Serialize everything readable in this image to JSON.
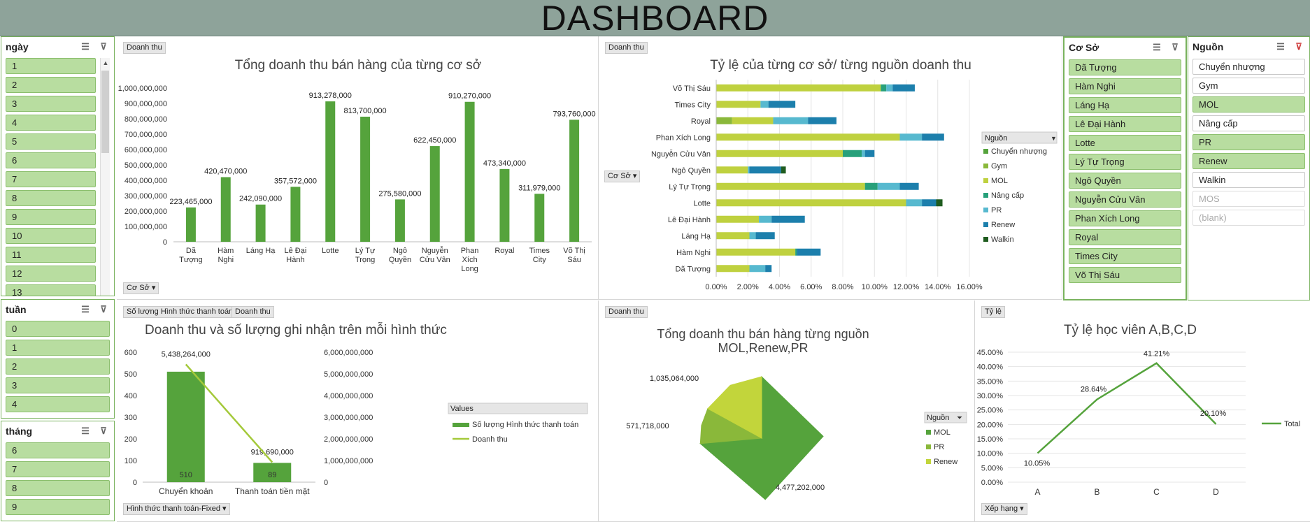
{
  "title": "DASHBOARD",
  "slicers": {
    "ngay": {
      "label": "ngày",
      "items": [
        "1",
        "2",
        "3",
        "4",
        "5",
        "6",
        "7",
        "8",
        "9",
        "10",
        "11",
        "12",
        "13"
      ]
    },
    "tuan": {
      "label": "tuần",
      "items": [
        "0",
        "1",
        "2",
        "3",
        "4"
      ]
    },
    "thang": {
      "label": "tháng",
      "items": [
        "6",
        "7",
        "8",
        "9"
      ]
    },
    "coso": {
      "label": "Cơ Sở",
      "items": [
        "Dã Tượng",
        "Hàm Nghi",
        "Láng Hạ",
        "Lê Đại Hành",
        "Lotte",
        "Lý Tự Trọng",
        "Ngô Quyền",
        "Nguyễn Cửu Vân",
        "Phan Xích Long",
        "Royal",
        "Times City",
        "Võ Thị Sáu"
      ]
    },
    "nguon": {
      "label": "Nguồn",
      "items": [
        {
          "label": "Chuyển nhượng",
          "state": "off"
        },
        {
          "label": "Gym",
          "state": "off"
        },
        {
          "label": "MOL",
          "state": "on"
        },
        {
          "label": "Nâng cấp",
          "state": "off"
        },
        {
          "label": "PR",
          "state": "on"
        },
        {
          "label": "Renew",
          "state": "on"
        },
        {
          "label": "Walkin",
          "state": "off"
        },
        {
          "label": "MOS",
          "state": "dim"
        },
        {
          "label": "(blank)",
          "state": "dim"
        }
      ]
    }
  },
  "panels": {
    "p1": {
      "field_button": "Doanh thu",
      "axis_button": "Cơ Sở"
    },
    "p2": {
      "field_button": "Doanh thu",
      "axis_button": "Cơ Sở"
    },
    "p3": {
      "field_button_1": "Số lượng Hình thức thanh toán",
      "field_button_2": "Doanh thu",
      "axis_button": "Hình thức thanh toán-Fixed"
    },
    "p4": {
      "field_button": "Doanh thu"
    },
    "p5": {
      "field_button": "Tỷ lệ",
      "axis_button": "Xếp hạng"
    }
  },
  "chart_data": [
    {
      "type": "bar",
      "title": "Tổng doanh thu bán hàng của từng cơ sở",
      "categories": [
        "Dã Tượng",
        "Hàm Nghi",
        "Láng Hạ",
        "Lê Đại Hành",
        "Lotte",
        "Lý Tự Trọng",
        "Ngô Quyền",
        "Nguyễn Cửu Vân",
        "Phan Xích Long",
        "Royal",
        "Times City",
        "Võ Thị Sáu"
      ],
      "category_lines": [
        [
          "Dã",
          "Tượng"
        ],
        [
          "Hàm",
          "Nghi"
        ],
        [
          "Láng Hạ"
        ],
        [
          "Lê Đại",
          "Hành"
        ],
        [
          "Lotte"
        ],
        [
          "Lý Tự",
          "Trọng"
        ],
        [
          "Ngô",
          "Quyền"
        ],
        [
          "Nguyễn",
          "Cửu Vân"
        ],
        [
          "Phan",
          "Xích",
          "Long"
        ],
        [
          "Royal"
        ],
        [
          "Times",
          "City"
        ],
        [
          "Võ Thị",
          "Sáu"
        ]
      ],
      "values": [
        223465000,
        420470000,
        242090000,
        357572000,
        913278000,
        813700000,
        275580000,
        622450000,
        910270000,
        473340000,
        311979000,
        793760000
      ],
      "data_labels": [
        "223,465,000",
        "420,470,000",
        "242,090,000",
        "357,572,000",
        "913,278,000",
        "813,700,000",
        "275,580,000",
        "622,450,000",
        "910,270,000",
        "473,340,000",
        "311,979,000",
        "793,760,000"
      ],
      "ylim": [
        0,
        1000000000
      ],
      "yticks": [
        "0",
        "100,000,000",
        "200,000,000",
        "300,000,000",
        "400,000,000",
        "500,000,000",
        "600,000,000",
        "700,000,000",
        "800,000,000",
        "900,000,000",
        "1,000,000,000"
      ],
      "color": "#55a33c"
    },
    {
      "type": "bar",
      "orientation": "horizontal",
      "stacked": true,
      "title": "Tỷ lệ của từng cơ sở/ từng nguồn doanh thu",
      "categories": [
        "Võ Thị Sáu",
        "Times City",
        "Royal",
        "Phan Xích Long",
        "Nguyễn Cửu Vân",
        "Ngô Quyền",
        "Lý Tự Trọng",
        "Lotte",
        "Lê Đại Hành",
        "Láng Hạ",
        "Hàm Nghi",
        "Dã Tượng"
      ],
      "series": [
        {
          "name": "Chuyển nhượng",
          "color": "#55a33c",
          "values": [
            0,
            0,
            0,
            0,
            0,
            0,
            0,
            0,
            0,
            0,
            0,
            0
          ]
        },
        {
          "name": "Gym",
          "color": "#8ab83a",
          "values": [
            0,
            0,
            1.0,
            0,
            0,
            0,
            0,
            0,
            0,
            0,
            0,
            0
          ]
        },
        {
          "name": "MOL",
          "color": "#bfd13f",
          "values": [
            10.4,
            2.8,
            2.6,
            11.6,
            8.0,
            2.0,
            9.4,
            12.0,
            2.7,
            2.1,
            5.0,
            2.1
          ]
        },
        {
          "name": "Nâng cấp",
          "color": "#27a07a",
          "values": [
            0.35,
            0,
            0,
            0,
            1.2,
            0,
            0.8,
            0,
            0,
            0,
            0.1,
            0
          ]
        },
        {
          "name": "PR",
          "color": "#57b9cf",
          "values": [
            0.4,
            0.5,
            2.2,
            1.4,
            0.2,
            0.1,
            1.4,
            1.0,
            0.8,
            0.4,
            0,
            1.0
          ]
        },
        {
          "name": "Renew",
          "color": "#1c7fac",
          "values": [
            1.4,
            1.7,
            1.8,
            1.4,
            0.6,
            2.0,
            1.2,
            0.9,
            2.1,
            1.2,
            1.5,
            0.4
          ]
        },
        {
          "name": "Walkin",
          "color": "#1f5c1f",
          "values": [
            0,
            0,
            0,
            0,
            0,
            0.3,
            0,
            0.4,
            0,
            0,
            0,
            0
          ]
        }
      ],
      "legend_title": "Nguồn",
      "xlim": [
        0,
        16
      ],
      "xticks": [
        "0.00%",
        "2.00%",
        "4.00%",
        "6.00%",
        "8.00%",
        "10.00%",
        "12.00%",
        "14.00%",
        "16.00%"
      ]
    },
    {
      "type": "bar",
      "combo": "bar+line",
      "title": "Doanh thu và số lượng ghi nhận trên mỗi hình thức",
      "categories": [
        "Chuyển khoản",
        "Thanh toán tiền mặt"
      ],
      "series": [
        {
          "name": "Số lượng Hình thức thanh toán",
          "type": "bar",
          "values": [
            510,
            89
          ],
          "labels": [
            "510",
            "89"
          ],
          "color": "#55a33c"
        },
        {
          "name": "Doanh thu",
          "type": "line",
          "values": [
            5438264000,
            919690000
          ],
          "labels": [
            "5,438,264,000",
            "919,690,000"
          ],
          "color": "#a4c93a"
        }
      ],
      "legend_title": "Values",
      "ylim": [
        0,
        600
      ],
      "yticks": [
        "0",
        "100",
        "200",
        "300",
        "400",
        "500",
        "600"
      ],
      "y2lim": [
        0,
        6000000000
      ],
      "y2ticks": [
        "0",
        "1,000,000,000",
        "2,000,000,000",
        "3,000,000,000",
        "4,000,000,000",
        "5,000,000,000",
        "6,000,000,000"
      ]
    },
    {
      "type": "pie",
      "title": "Tổng doanh thu bán hàng từng nguồn MOL,Renew,PR",
      "title_lines": [
        "Tổng doanh thu bán hàng từng nguồn",
        "MOL,Renew,PR"
      ],
      "categories": [
        "MOL",
        "PR",
        "Renew"
      ],
      "values": [
        4477202000,
        571718000,
        1035064000
      ],
      "labels": [
        "4,477,202,000",
        "571,718,000",
        "1,035,064,000"
      ],
      "colors": [
        "#55a33c",
        "#8ab83a",
        "#c2d53b"
      ],
      "legend_title": "Nguồn"
    },
    {
      "type": "line",
      "title": "Tỷ lệ học viên A,B,C,D",
      "categories": [
        "A",
        "B",
        "C",
        "D"
      ],
      "series": [
        {
          "name": "Total",
          "values": [
            10.05,
            28.64,
            41.21,
            20.1
          ],
          "labels": [
            "10.05%",
            "28.64%",
            "41.21%",
            "20.10%"
          ],
          "color": "#55a33c"
        }
      ],
      "ylim": [
        0,
        45
      ],
      "yticks": [
        "0.00%",
        "5.00%",
        "10.00%",
        "15.00%",
        "20.00%",
        "25.00%",
        "30.00%",
        "35.00%",
        "40.00%",
        "45.00%"
      ]
    }
  ]
}
